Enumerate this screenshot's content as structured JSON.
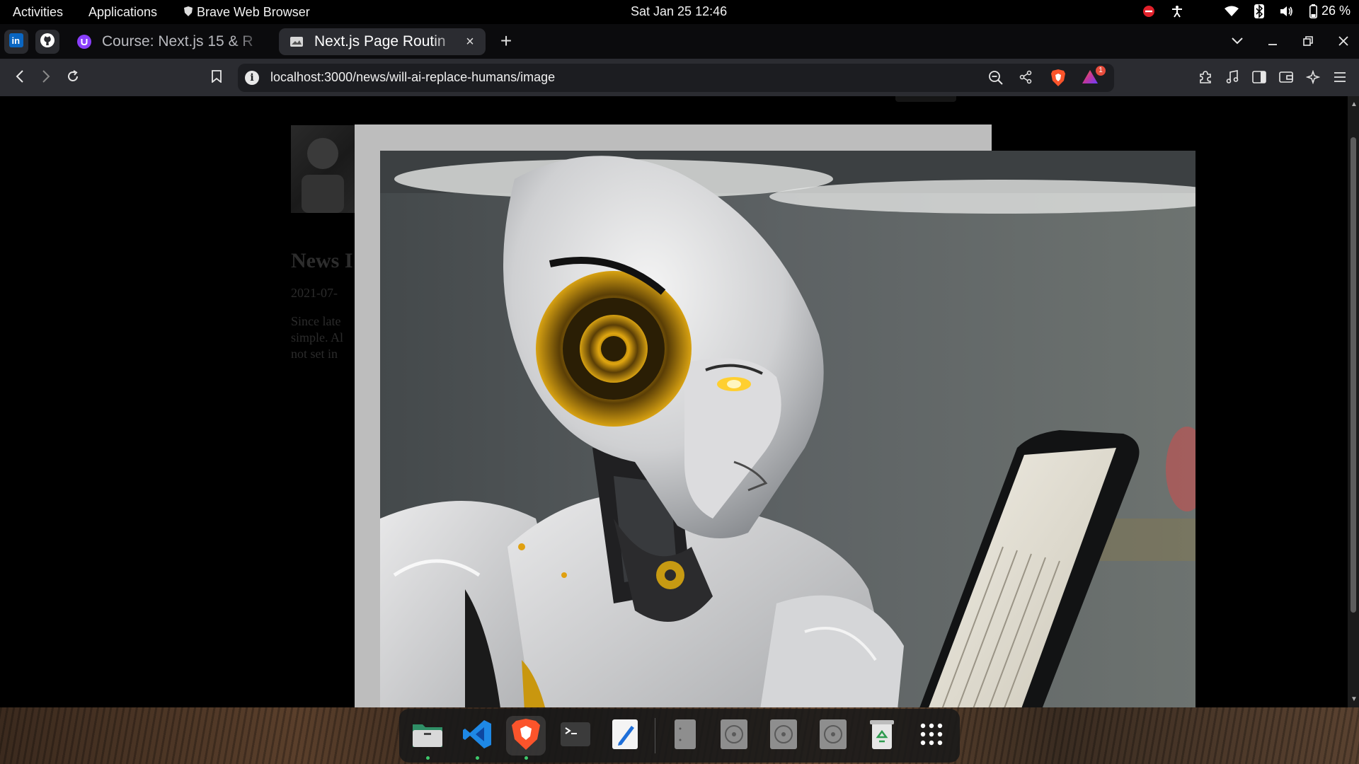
{
  "topbar": {
    "activities": "Activities",
    "applications": "Applications",
    "app_indicator": "Brave Web Browser",
    "clock": "Sat Jan 25  12:46",
    "battery": "26 %"
  },
  "tabs": {
    "pinned": [
      "linkedin",
      "github"
    ],
    "items": [
      {
        "title": "Course: Next.js 15 & R",
        "favicon": "course-icon"
      },
      {
        "title": "Next.js Page Routin",
        "favicon": "page-icon"
      }
    ],
    "new_tab": "+",
    "close": "×"
  },
  "navbar": {
    "url": "localhost:3000/news/will-ai-replace-humans/image",
    "info_icon": "i",
    "rewards_count": "1"
  },
  "article": {
    "title": "News I",
    "date": "2021-07-",
    "body_lines": [
      "Since late",
      "simple. Al",
      "not set in"
    ]
  },
  "colors": {
    "modal_bg": "#bdbdbd",
    "tab_active": "#2b2c31",
    "brave_orange": "#fb542b"
  }
}
